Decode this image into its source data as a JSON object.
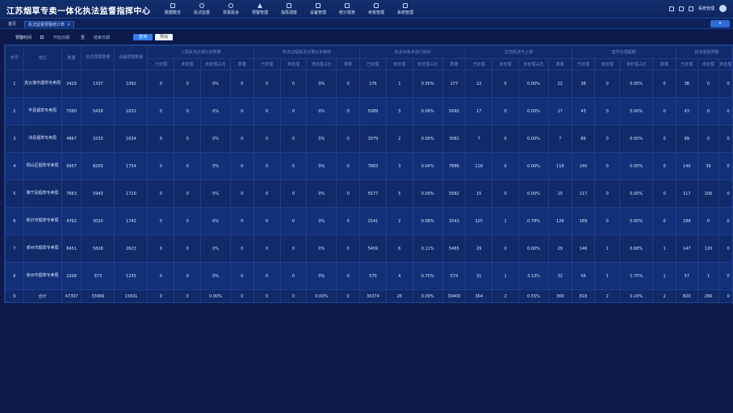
{
  "header": {
    "title": "江苏烟草专卖一体化执法监督指挥中心",
    "nav": [
      {
        "label": "数据概览",
        "icon": "square"
      },
      {
        "label": "执法监督",
        "icon": "round"
      },
      {
        "label": "举报投诉",
        "icon": "round"
      },
      {
        "label": "预警管理",
        "icon": "tri"
      },
      {
        "label": "指挥调度",
        "icon": "square"
      },
      {
        "label": "设备管理",
        "icon": "square"
      },
      {
        "label": "统计报表",
        "icon": "square"
      },
      {
        "label": "考核管理",
        "icon": "square"
      },
      {
        "label": "系统管理",
        "icon": "square"
      }
    ],
    "user": "系统管理"
  },
  "tabs": {
    "home": "首页",
    "active": "执法监督预警统计表",
    "close": "×",
    "page_button": "▾"
  },
  "filters": {
    "time_label": "预警时间",
    "start_placeholder": "开始日期",
    "separator": "至",
    "end_placeholder": "结束日期",
    "query_label": "查询",
    "export_label": "导出"
  },
  "table": {
    "group_headers": [
      "人员执法记录仪未携带",
      "执法过程执法记录仪未使用",
      "执法对象未进行核对",
      "异地执法不上报",
      "案件办理超期",
      "执法监督预警"
    ],
    "sub_headers": [
      "已处理",
      "未处理",
      "未处理占比",
      "数量"
    ],
    "sub_headers_short": [
      "已处理",
      "未处理",
      "未处理占比"
    ],
    "col_headers": {
      "index": "序号",
      "unit": "单位",
      "total": "数量",
      "completed": "执法预警数量",
      "unfinished": "设备预警数量"
    },
    "rows": [
      {
        "idx": "1",
        "unit": "连云港市烟草专卖局",
        "v": [
          "2429",
          "1337",
          "1092",
          "0",
          "0",
          "0%",
          "0",
          "0",
          "0",
          "0%",
          "0",
          "176",
          "1",
          "0.56%",
          "177",
          "22",
          "0",
          "0.00%",
          "22",
          "38",
          "0",
          "0.00%",
          "0",
          "38",
          "0",
          "0"
        ]
      },
      {
        "idx": "2",
        "unit": "丰县烟草专卖局",
        "v": [
          "7060",
          "5429",
          "1631",
          "0",
          "0",
          "0%",
          "0",
          "0",
          "0",
          "0%",
          "0",
          "5089",
          "3",
          "0.06%",
          "5092",
          "17",
          "0",
          "0.00%",
          "17",
          "43",
          "0",
          "0.00%",
          "0",
          "43",
          "0",
          "0"
        ]
      },
      {
        "idx": "3",
        "unit": "沛县烟草专卖局",
        "v": [
          "4867",
          "3233",
          "1634",
          "0",
          "0",
          "0%",
          "0",
          "0",
          "0",
          "0%",
          "0",
          "3079",
          "2",
          "0.06%",
          "3081",
          "7",
          "0",
          "0.00%",
          "7",
          "89",
          "0",
          "0.00%",
          "0",
          "89",
          "0",
          "0"
        ]
      },
      {
        "idx": "4",
        "unit": "铜山区烟草专卖局",
        "v": [
          "9957",
          "8203",
          "1754",
          "0",
          "0",
          "0%",
          "0",
          "0",
          "0",
          "0%",
          "0",
          "7883",
          "3",
          "0.04%",
          "7886",
          "118",
          "0",
          "0.00%",
          "118",
          "140",
          "0",
          "0.00%",
          "0",
          "140",
          "39",
          "0"
        ]
      },
      {
        "idx": "5",
        "unit": "睢宁县烟草专卖局",
        "v": [
          "7663",
          "5943",
          "1720",
          "0",
          "0",
          "0%",
          "0",
          "0",
          "0",
          "0%",
          "0",
          "5577",
          "5",
          "0.09%",
          "5582",
          "15",
          "0",
          "0.00%",
          "15",
          "117",
          "0",
          "0.00%",
          "0",
          "117",
          "106",
          "0"
        ]
      },
      {
        "idx": "6",
        "unit": "新沂市烟草专卖局",
        "v": [
          "4762",
          "3020",
          "1742",
          "0",
          "0",
          "0%",
          "0",
          "0",
          "0",
          "0%",
          "0",
          "2541",
          "2",
          "0.08%",
          "2543",
          "125",
          "1",
          "0.79%",
          "126",
          "189",
          "0",
          "0.00%",
          "0",
          "189",
          "0",
          "0"
        ]
      },
      {
        "idx": "7",
        "unit": "邳州市烟草专卖局",
        "v": [
          "8451",
          "5828",
          "2623",
          "0",
          "0",
          "0%",
          "0",
          "0",
          "0",
          "0%",
          "0",
          "5459",
          "6",
          "0.11%",
          "5465",
          "29",
          "0",
          "0.00%",
          "29",
          "146",
          "1",
          "0.68%",
          "1",
          "147",
          "120",
          "0"
        ]
      },
      {
        "idx": "8",
        "unit": "徐州市烟草专卖局",
        "v": [
          "2208",
          "973",
          "1235",
          "0",
          "0",
          "0%",
          "0",
          "0",
          "0",
          "0%",
          "0",
          "570",
          "4",
          "0.70%",
          "574",
          "31",
          "1",
          "3.13%",
          "32",
          "56",
          "1",
          "1.75%",
          "1",
          "57",
          "1",
          "0"
        ]
      }
    ],
    "total": {
      "idx": "9",
      "unit": "合计",
      "v": [
        "47397",
        "33966",
        "13431",
        "0",
        "0",
        "0.00%",
        "0",
        "0",
        "0",
        "0.00%",
        "0",
        "30374",
        "26",
        "0.09%",
        "30400",
        "364",
        "2",
        "0.55%",
        "366",
        "818",
        "2",
        "0.24%",
        "2",
        "820",
        "266",
        "0"
      ]
    }
  }
}
